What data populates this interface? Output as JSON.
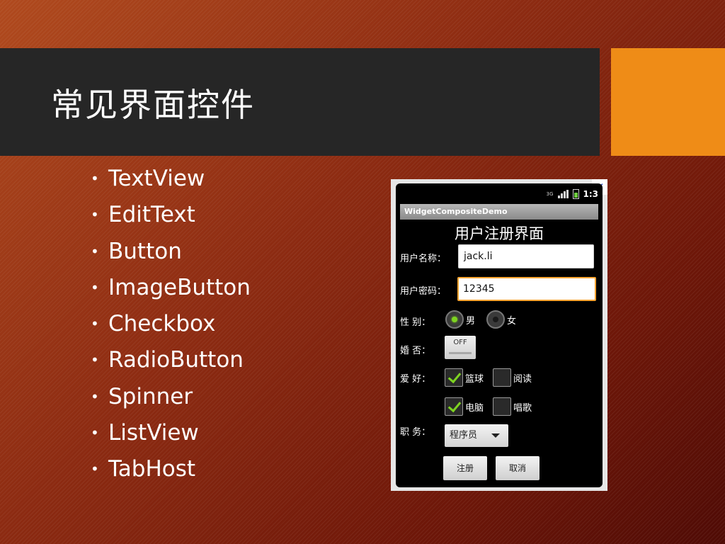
{
  "slide": {
    "title": "常见界面控件",
    "bullets": [
      "TextView",
      "EditText",
      "Button",
      "ImageButton",
      "Checkbox",
      "RadioButton",
      "Spinner",
      "ListView",
      "TabHost"
    ],
    "bullet_glyph": "•",
    "colors": {
      "title_bar": "#262626",
      "accent": "#ef8c17",
      "background": "#8e2c12"
    }
  },
  "phone": {
    "close_glyph": "✕",
    "status": {
      "network": "3G",
      "time": "1:3"
    },
    "app_title": "WidgetCompositeDemo",
    "form_title": "用户注册界面",
    "username_label": "用户名称：",
    "username_value": "jack.li",
    "password_label": "用户密码：",
    "password_value": "12345",
    "gender_label": "性 别：",
    "gender_options": [
      {
        "label": "男",
        "checked": true
      },
      {
        "label": "女",
        "checked": false
      }
    ],
    "married_label": "婚 否：",
    "married_toggle": "OFF",
    "hobby_label": "爱 好：",
    "hobbies": [
      {
        "label": "篮球",
        "checked": true
      },
      {
        "label": "阅读",
        "checked": false
      },
      {
        "label": "电脑",
        "checked": true
      },
      {
        "label": "唱歌",
        "checked": false
      }
    ],
    "job_label": "职 务：",
    "job_selected": "程序员",
    "register_button": "注册",
    "cancel_button": "取消"
  }
}
